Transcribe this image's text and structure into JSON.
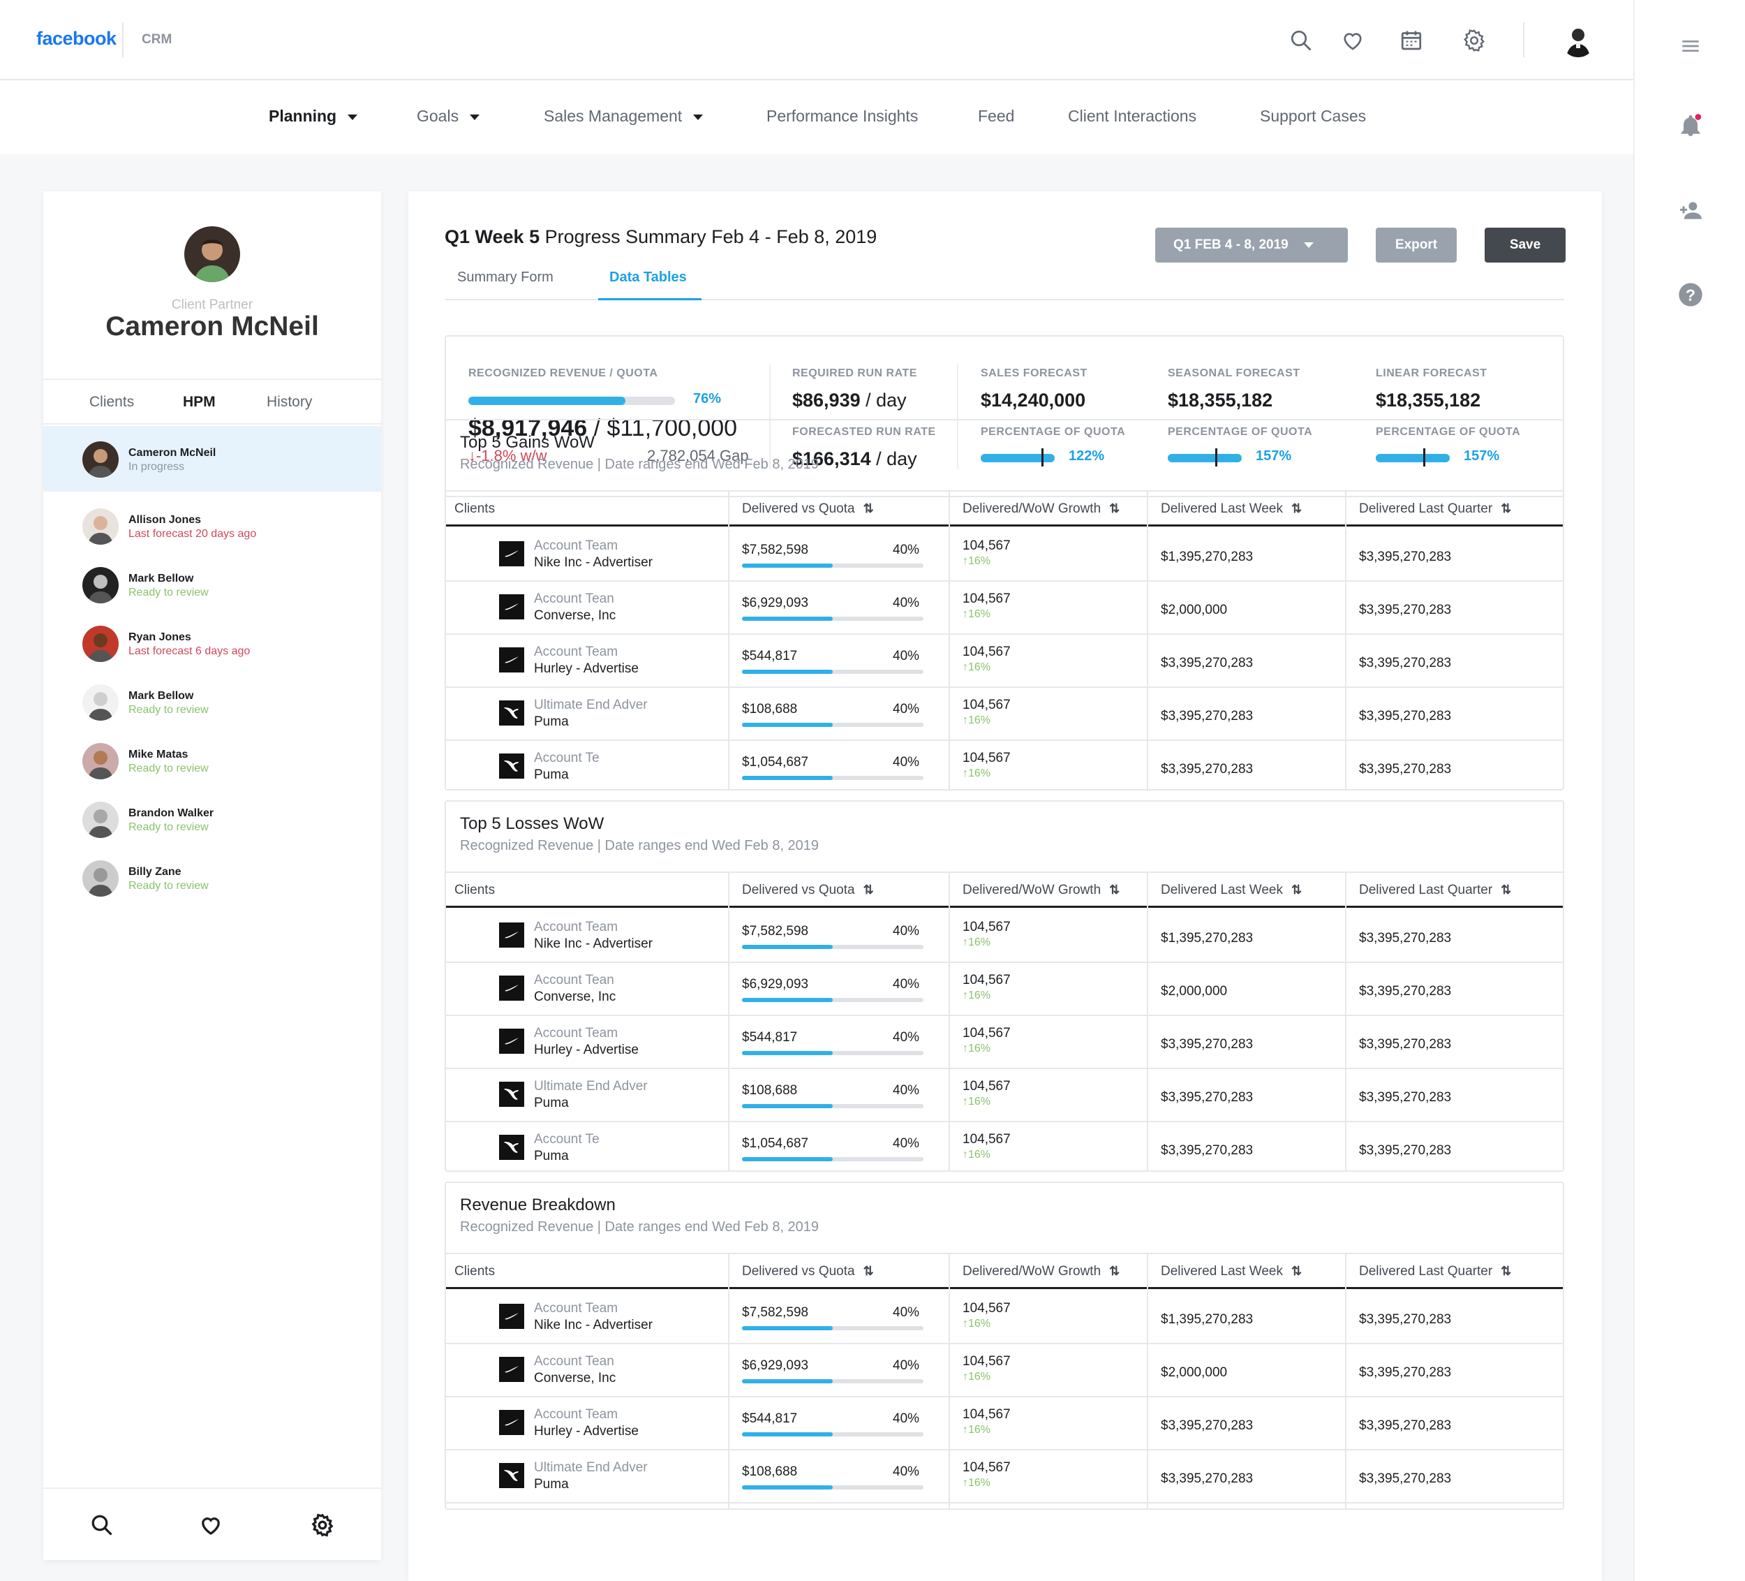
{
  "app": {
    "brand": "facebook",
    "product": "CRM"
  },
  "topbar": {
    "icons": [
      "search-icon",
      "heart-icon",
      "calendar-icon",
      "gear-icon"
    ]
  },
  "nav": {
    "items": [
      {
        "label": "Planning",
        "active": true,
        "dropdown": true
      },
      {
        "label": "Goals",
        "dropdown": true
      },
      {
        "label": "Sales Management",
        "dropdown": true
      },
      {
        "label": "Performance Insights"
      },
      {
        "label": "Feed"
      },
      {
        "label": "Client Interactions"
      },
      {
        "label": "Support Cases"
      }
    ]
  },
  "sidebar": {
    "role": "Client Partner",
    "name": "Cameron McNeil",
    "tabs": [
      "Clients",
      "HPM",
      "History"
    ],
    "active_tab": "HPM",
    "clients": [
      {
        "name": "Cameron McNeil",
        "status": "In progress",
        "tone": "prog",
        "selected": true
      },
      {
        "name": "Allison Jones",
        "status": "Last forecast 20 days ago",
        "tone": "red"
      },
      {
        "name": "Mark Bellow",
        "status": "Ready to review",
        "tone": "green"
      },
      {
        "name": "Ryan Jones",
        "status": "Last forecast 6 days ago",
        "tone": "red"
      },
      {
        "name": "Mark Bellow",
        "status": "Ready to review",
        "tone": "green"
      },
      {
        "name": "Mike Matas",
        "status": "Ready to review",
        "tone": "green"
      },
      {
        "name": "Brandon Walker",
        "status": "Ready to review",
        "tone": "green"
      },
      {
        "name": "Billy Zane",
        "status": "Ready to review",
        "tone": "green"
      }
    ]
  },
  "main": {
    "title_bold": "Q1 Week 5",
    "title_rest": " Progress Summary Feb 4 - Feb 8, 2019",
    "tabs": [
      "Summary Form",
      "Data Tables"
    ],
    "active_tab": "Data Tables",
    "date_button": "Q1 FEB 4 - 8, 2019",
    "export_label": "Export",
    "save_label": "Save"
  },
  "summary": {
    "recognized": {
      "label": "RECOGNIZED REVENUE / QUOTA",
      "progress": 0.76,
      "pct": "76%",
      "value": "$8,917,946",
      "quota": " / $11,700,000",
      "delta": "-1.8% w/w",
      "gap": "2,782,054 Gap"
    },
    "required": {
      "label": "REQUIRED RUN RATE",
      "value": "$86,939",
      "unit": " / day"
    },
    "forecasted": {
      "label": "FORECASTED RUN RATE",
      "value": "$166,314",
      "unit": " / day"
    },
    "sales": {
      "label": "SALES FORECAST",
      "value": "$14,240,000",
      "pct_label": "PERCENTAGE OF QUOTA",
      "pct": "122%",
      "level": 1.22
    },
    "seasonal": {
      "label": "SEASONAL FORECAST",
      "value": "$18,355,182",
      "pct_label": "PERCENTAGE OF QUOTA",
      "pct": "157%",
      "level": 1.57
    },
    "linear": {
      "label": "LINEAR FORECAST",
      "value": "$18,355,182",
      "pct_label": "PERCENTAGE OF QUOTA",
      "pct": "157%",
      "level": 1.57
    }
  },
  "columns": [
    "Clients",
    "Delivered vs Quota",
    "Delivered/WoW Growth",
    "Delivered Last Week",
    "Delivered Last Quarter"
  ],
  "sections": [
    {
      "title": "Top 5 Gains WoW",
      "subtitle": "Recognized Revenue | Date ranges end Wed Feb 8, 2019"
    },
    {
      "title": "Top 5 Losses WoW",
      "subtitle": "Recognized Revenue | Date ranges end Wed Feb 8, 2019"
    },
    {
      "title": "Revenue Breakdown",
      "subtitle": "Recognized Revenue | Date ranges end Wed Feb 8, 2019"
    }
  ],
  "rows": [
    {
      "logo": "nike",
      "line1": "Account Team",
      "line2": "Nike Inc - Advertiser",
      "quota": "$7,582,598",
      "qpct": "40%",
      "qlevel": 0.5,
      "growth": "104,567",
      "gpct": "16%",
      "last_week": "$1,395,270,283",
      "last_quarter": "$3,395,270,283"
    },
    {
      "logo": "nike",
      "line1": "Account Tean",
      "line2": "Converse, Inc",
      "quota": "$6,929,093",
      "qpct": "40%",
      "qlevel": 0.5,
      "growth": "104,567",
      "gpct": "16%",
      "last_week": "$2,000,000",
      "last_quarter": "$3,395,270,283"
    },
    {
      "logo": "nike",
      "line1": "Account Team",
      "line2": "Hurley - Advertise",
      "quota": "$544,817",
      "qpct": "40%",
      "qlevel": 0.5,
      "growth": "104,567",
      "gpct": "16%",
      "last_week": "$3,395,270,283",
      "last_quarter": "$3,395,270,283"
    },
    {
      "logo": "puma",
      "line1": "Ultimate End Adver",
      "line2": "Puma",
      "quota": "$108,688",
      "qpct": "40%",
      "qlevel": 0.5,
      "growth": "104,567",
      "gpct": "16%",
      "last_week": "$3,395,270,283",
      "last_quarter": "$3,395,270,283"
    },
    {
      "logo": "puma",
      "line1": "Account Te",
      "line2": "Puma",
      "quota": "$1,054,687",
      "qpct": "40%",
      "qlevel": 0.5,
      "growth": "104,567",
      "gpct": "16%",
      "last_week": "$3,395,270,283",
      "last_quarter": "$3,395,270,283"
    }
  ],
  "sort_glyph": "⇅",
  "up_arrow": "↑",
  "down_arrow": "↓"
}
